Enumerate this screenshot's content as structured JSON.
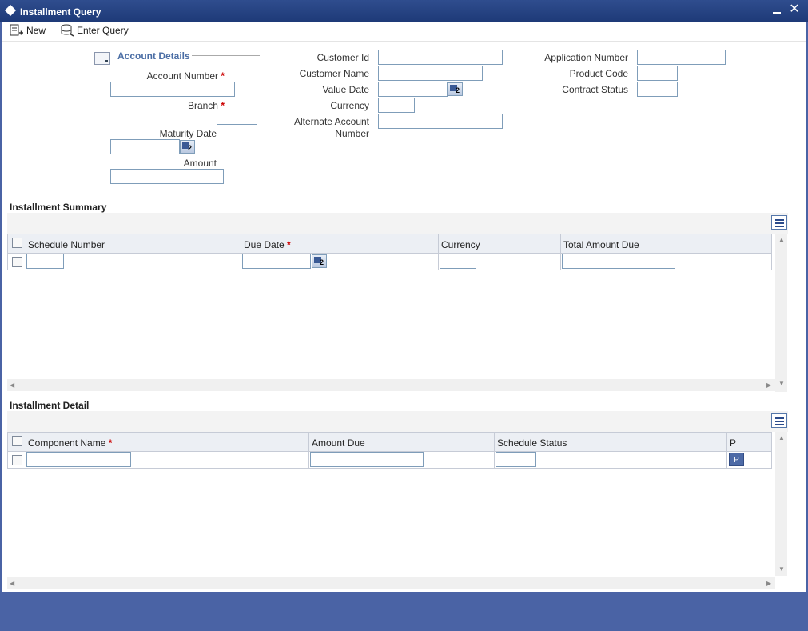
{
  "window": {
    "title": "Installment Query",
    "min_icon": "minimize-icon",
    "close_icon": "close-icon"
  },
  "toolbar": {
    "new_label": "New",
    "enter_query_label": "Enter Query"
  },
  "account_details": {
    "legend": "Account Details",
    "account_number_label": "Account Number",
    "branch_label": "Branch",
    "maturity_date_label": "Maturity Date",
    "amount_label": "Amount",
    "required_mark": "*"
  },
  "customer": {
    "customer_id_label": "Customer Id",
    "customer_name_label": "Customer Name",
    "value_date_label": "Value Date",
    "currency_label": "Currency",
    "alternate_account_label_1": "Alternate Account",
    "alternate_account_label_2": "Number"
  },
  "application": {
    "application_number_label": "Application Number",
    "product_code_label": "Product Code",
    "contract_status_label": "Contract Status"
  },
  "installment_summary": {
    "title": "Installment Summary",
    "columns": [
      "Schedule Number",
      "Due Date",
      "Currency",
      "Total Amount Due"
    ]
  },
  "installment_detail": {
    "title": "Installment Detail",
    "columns": [
      "Component Name",
      "Amount Due",
      "Schedule Status",
      "P"
    ],
    "p_button": "P"
  },
  "colors": {
    "title_bar": "#1e3a78",
    "frame": "#4a63a5",
    "legend": "#4b6ea5",
    "required": "#cc0000"
  }
}
